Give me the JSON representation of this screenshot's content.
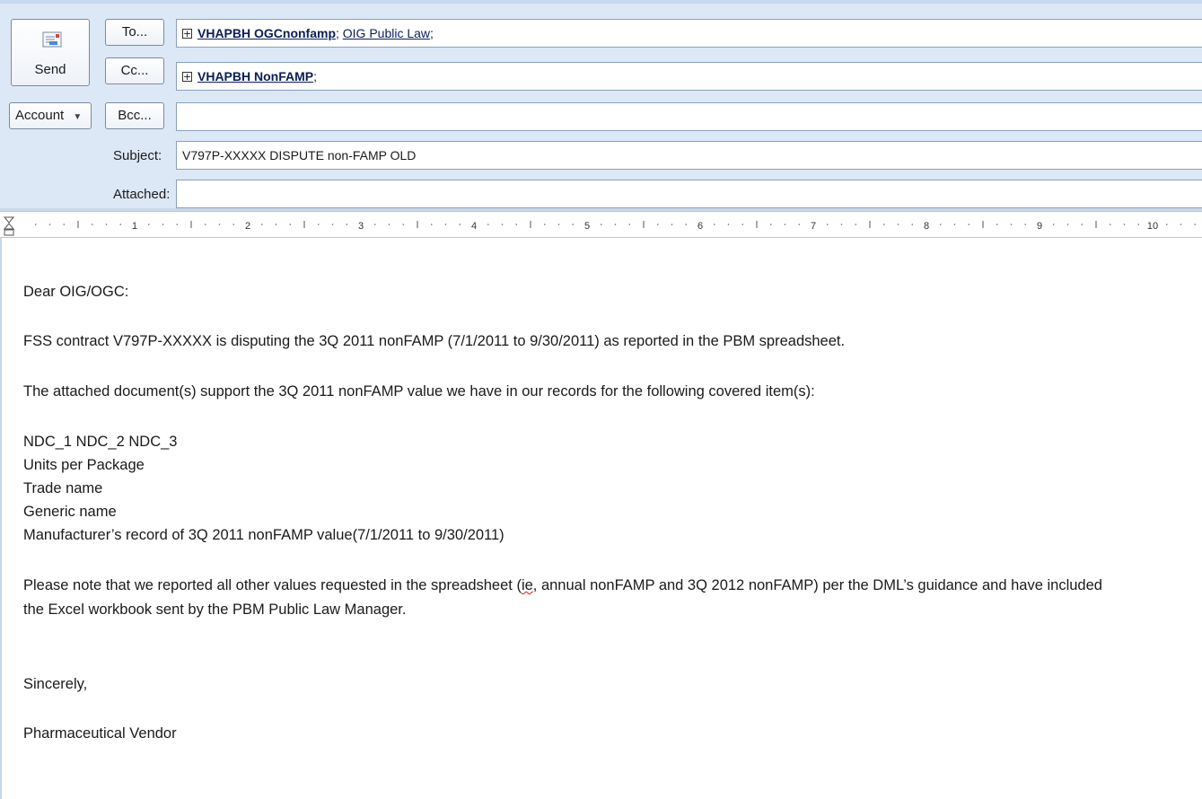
{
  "toolbar": {
    "send_label": "Send",
    "to_label": "To...",
    "cc_label": "Cc...",
    "bcc_label": "Bcc...",
    "account_label": "Account",
    "subject_label": "Subject:",
    "attached_label": "Attached:"
  },
  "fields": {
    "to": [
      {
        "name": "VHAPBH OGCnonfamp",
        "bold": true
      },
      {
        "name": "OIG Public Law",
        "bold": false
      }
    ],
    "cc": [
      {
        "name": "VHAPBH NonFAMP",
        "bold": true
      }
    ],
    "bcc": "",
    "subject": "V797P-XXXXX DISPUTE non-FAMP OLD",
    "attached": ""
  },
  "ruler": {
    "numbers": [
      "1",
      "2",
      "3",
      "4",
      "5",
      "6",
      "7",
      "8",
      "9",
      "10"
    ]
  },
  "body": {
    "greeting": "Dear OIG/OGC:",
    "para1": "FSS contract V797P-XXXXX is disputing the 3Q 2011 nonFAMP (7/1/2011 to 9/30/2011) as reported in the PBM spreadsheet.",
    "para2": "The attached document(s) support the 3Q 2011 nonFAMP value we have in our records for the following covered item(s):",
    "items": [
      "NDC_1  NDC_2  NDC_3",
      "Units per Package",
      "Trade name",
      "Generic name",
      "Manufacturer’s record of 3Q 2011 nonFAMP value(7/1/2011 to 9/30/2011)"
    ],
    "para3_a": "Please note that we reported all other values requested in the spreadsheet (",
    "para3_ie": "ie",
    "para3_b": ", annual nonFAMP and 3Q 2012 nonFAMP) per the DML’s guidance and have included",
    "para3_line2": "the Excel workbook sent by the PBM Public Law Manager.",
    "closing": "Sincerely,",
    "signature": "Pharmaceutical Vendor"
  }
}
